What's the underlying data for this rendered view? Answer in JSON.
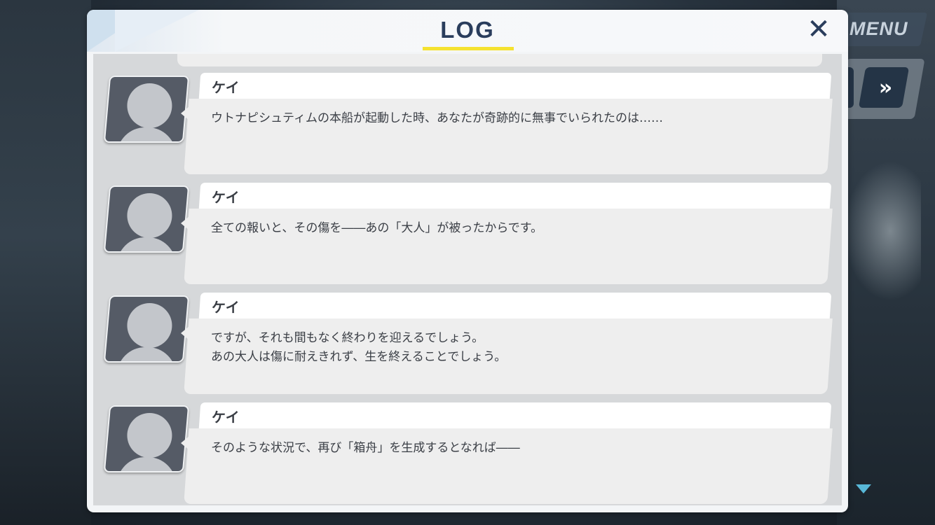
{
  "header": {
    "title": "LOG",
    "close_icon": "close-icon"
  },
  "side_controls": {
    "menu_label": "MENU",
    "skip_icon": "fast-forward-icon",
    "skip_symbol": "»"
  },
  "entries": [
    {
      "speaker": "ケイ",
      "message": "ウトナピシュティムの本船が起動した時、あなたが奇跡的に無事でいられたのは……"
    },
    {
      "speaker": "ケイ",
      "message": "全ての報いと、その傷を――あの「大人」が被ったからです。"
    },
    {
      "speaker": "ケイ",
      "message": "ですが、それも間もなく終わりを迎えるでしょう。\nあの大人は傷に耐えきれず、生を終えることでしょう。"
    },
    {
      "speaker": "ケイ",
      "message": "そのような状況で、再び「箱舟」を生成するとなれば――"
    }
  ],
  "colors": {
    "title": "#2a3d5c",
    "underline": "#f5e230",
    "scroll_indicator": "#58b8d8"
  }
}
